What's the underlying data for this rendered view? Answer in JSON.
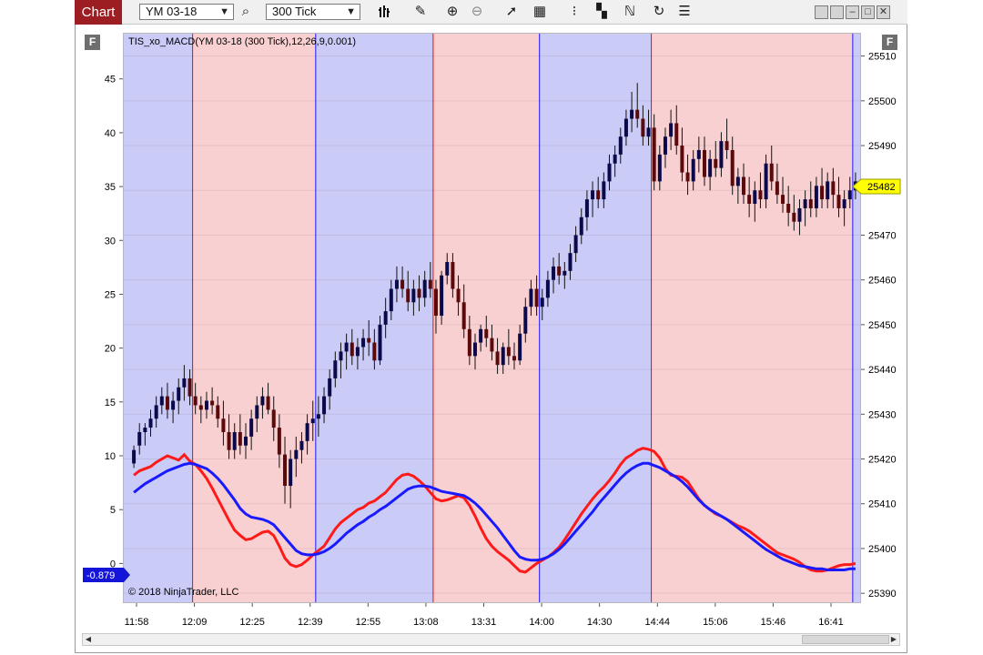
{
  "toolbar": {
    "tab_label": "Chart",
    "instrument": "YM 03-18",
    "interval": "300 Tick",
    "icons": [
      "search-icon",
      "bar-type-icon",
      "pencil-icon",
      "zoom-in-icon",
      "zoom-out-icon",
      "cursor-icon",
      "data-box-icon",
      "chart-trader-icon",
      "templates-icon",
      "strategies-icon",
      "refresh-icon",
      "properties-icon"
    ]
  },
  "badges": {
    "left_f": "F",
    "right_f": "F"
  },
  "indicator_label": "TIS_xo_MACD(YM 03-18 (300 Tick),12,26,9,0.001)",
  "copyright": "© 2018 NinjaTrader, LLC",
  "left_marker": "-0.879",
  "right_marker": "25482",
  "colors": {
    "up_candle": "#0a0a4a",
    "down_candle": "#5a0a0a",
    "blue_zone": "#cbcbf7",
    "red_zone": "#f9d0d2",
    "macd": "#ff1a1a",
    "signal": "#1a1aff"
  },
  "chart_data": {
    "type": "candlestick_with_indicator",
    "title": "",
    "x_tick_labels": [
      "11:58",
      "12:09",
      "12:25",
      "12:39",
      "12:55",
      "13:08",
      "13:31",
      "14:00",
      "14:30",
      "14:44",
      "15:06",
      "15:46",
      "16:41"
    ],
    "price_axis": {
      "ticks": [
        25390,
        25400,
        25410,
        25420,
        25430,
        25440,
        25450,
        25460,
        25470,
        25480,
        25490,
        25500,
        25510
      ],
      "ylim": [
        25388,
        25515
      ]
    },
    "indicator_axis": {
      "ticks": [
        0,
        5,
        10,
        15,
        20,
        25,
        30,
        35,
        40,
        45
      ],
      "ylim": [
        -3.6,
        49.2
      ]
    },
    "zones": [
      {
        "color": "blue",
        "start": 0,
        "end": 11
      },
      {
        "color": "red",
        "start": 11,
        "end": 33
      },
      {
        "color": "blue",
        "start": 33,
        "end": 54
      },
      {
        "color": "red",
        "start": 54,
        "end": 73
      },
      {
        "color": "blue",
        "start": 73,
        "end": 93
      },
      {
        "color": "red",
        "start": 93,
        "end": 129
      },
      {
        "color": "blue",
        "start": 129,
        "end": 130
      }
    ],
    "candles": [
      [
        25419,
        25423,
        25418,
        25422
      ],
      [
        25423,
        25428,
        25421,
        25426
      ],
      [
        25426,
        25428,
        25423,
        25427
      ],
      [
        25427,
        25431,
        25425,
        25429
      ],
      [
        25429,
        25434,
        25427,
        25432
      ],
      [
        25432,
        25436,
        25430,
        25434
      ],
      [
        25434,
        25437,
        25429,
        25431
      ],
      [
        25431,
        25435,
        25428,
        25433
      ],
      [
        25433,
        25438,
        25430,
        25436
      ],
      [
        25436,
        25441,
        25433,
        25438
      ],
      [
        25438,
        25440,
        25432,
        25434
      ],
      [
        25434,
        25437,
        25430,
        25432
      ],
      [
        25432,
        25434,
        25428,
        25431
      ],
      [
        25431,
        25435,
        25429,
        25433
      ],
      [
        25433,
        25436,
        25430,
        25432
      ],
      [
        25432,
        25434,
        25427,
        25429
      ],
      [
        25429,
        25433,
        25423,
        25426
      ],
      [
        25426,
        25430,
        25420,
        25422
      ],
      [
        25422,
        25428,
        25420,
        25426
      ],
      [
        25426,
        25430,
        25421,
        25423
      ],
      [
        25423,
        25428,
        25420,
        25425
      ],
      [
        25425,
        25431,
        25422,
        25429
      ],
      [
        25429,
        25434,
        25426,
        25432
      ],
      [
        25432,
        25436,
        25429,
        25434
      ],
      [
        25434,
        25437,
        25430,
        25431
      ],
      [
        25431,
        25434,
        25424,
        25427
      ],
      [
        25427,
        25430,
        25418,
        25421
      ],
      [
        25421,
        25425,
        25410,
        25414
      ],
      [
        25414,
        25422,
        25409,
        25420
      ],
      [
        25420,
        25425,
        25416,
        25422
      ],
      [
        25422,
        25426,
        25419,
        25424
      ],
      [
        25424,
        25430,
        25421,
        25428
      ],
      [
        25428,
        25433,
        25424,
        25429
      ],
      [
        25429,
        25434,
        25425,
        25430
      ],
      [
        25430,
        25436,
        25428,
        25434
      ],
      [
        25434,
        25440,
        25431,
        25438
      ],
      [
        25438,
        25444,
        25436,
        25442
      ],
      [
        25442,
        25446,
        25438,
        25444
      ],
      [
        25444,
        25448,
        25440,
        25446
      ],
      [
        25446,
        25449,
        25441,
        25443
      ],
      [
        25443,
        25447,
        25440,
        25445
      ],
      [
        25445,
        25449,
        25442,
        25447
      ],
      [
        25447,
        25451,
        25443,
        25446
      ],
      [
        25446,
        25449,
        25440,
        25442
      ],
      [
        25442,
        25452,
        25441,
        25450
      ],
      [
        25450,
        25456,
        25447,
        25453
      ],
      [
        25453,
        25460,
        25451,
        25458
      ],
      [
        25458,
        25463,
        25455,
        25460
      ],
      [
        25460,
        25463,
        25456,
        25458
      ],
      [
        25458,
        25462,
        25453,
        25455
      ],
      [
        25455,
        25460,
        25452,
        25458
      ],
      [
        25458,
        25461,
        25453,
        25456
      ],
      [
        25456,
        25462,
        25454,
        25460
      ],
      [
        25460,
        25464,
        25456,
        25458
      ],
      [
        25458,
        25460,
        25448,
        25452
      ],
      [
        25452,
        25462,
        25450,
        25461
      ],
      [
        25461,
        25466,
        25459,
        25464
      ],
      [
        25464,
        25466,
        25456,
        25458
      ],
      [
        25458,
        25461,
        25452,
        25455
      ],
      [
        25455,
        25459,
        25447,
        25449
      ],
      [
        25449,
        25452,
        25441,
        25443
      ],
      [
        25443,
        25448,
        25440,
        25446
      ],
      [
        25446,
        25450,
        25444,
        25449
      ],
      [
        25449,
        25452,
        25445,
        25447
      ],
      [
        25447,
        25450,
        25442,
        25444
      ],
      [
        25444,
        25447,
        25439,
        25441
      ],
      [
        25441,
        25446,
        25439,
        25445
      ],
      [
        25445,
        25449,
        25441,
        25443
      ],
      [
        25443,
        25446,
        25440,
        25442
      ],
      [
        25442,
        25450,
        25441,
        25448
      ],
      [
        25448,
        25456,
        25446,
        25454
      ],
      [
        25454,
        25460,
        25452,
        25458
      ],
      [
        25458,
        25461,
        25452,
        25454
      ],
      [
        25454,
        25458,
        25451,
        25456
      ],
      [
        25456,
        25462,
        25454,
        25460
      ],
      [
        25460,
        25465,
        25457,
        25463
      ],
      [
        25463,
        25466,
        25459,
        25461
      ],
      [
        25461,
        25464,
        25458,
        25462
      ],
      [
        25462,
        25468,
        25460,
        25466
      ],
      [
        25466,
        25472,
        25464,
        25470
      ],
      [
        25470,
        25476,
        25468,
        25474
      ],
      [
        25474,
        25480,
        25471,
        25478
      ],
      [
        25478,
        25482,
        25474,
        25480
      ],
      [
        25480,
        25483,
        25476,
        25478
      ],
      [
        25478,
        25484,
        25476,
        25482
      ],
      [
        25482,
        25488,
        25480,
        25486
      ],
      [
        25486,
        25490,
        25483,
        25488
      ],
      [
        25488,
        25494,
        25486,
        25492
      ],
      [
        25492,
        25498,
        25490,
        25496
      ],
      [
        25496,
        25502,
        25493,
        25498
      ],
      [
        25498,
        25504,
        25494,
        25496
      ],
      [
        25496,
        25499,
        25490,
        25492
      ],
      [
        25492,
        25498,
        25490,
        25494
      ],
      [
        25494,
        25497,
        25480,
        25482
      ],
      [
        25482,
        25490,
        25480,
        25488
      ],
      [
        25488,
        25494,
        25485,
        25492
      ],
      [
        25492,
        25498,
        25489,
        25495
      ],
      [
        25495,
        25499,
        25488,
        25490
      ],
      [
        25490,
        25494,
        25482,
        25484
      ],
      [
        25484,
        25488,
        25479,
        25482
      ],
      [
        25482,
        25489,
        25480,
        25487
      ],
      [
        25487,
        25492,
        25484,
        25489
      ],
      [
        25489,
        25492,
        25481,
        25483
      ],
      [
        25483,
        25489,
        25480,
        25487
      ],
      [
        25487,
        25491,
        25483,
        25485
      ],
      [
        25485,
        25493,
        25483,
        25491
      ],
      [
        25491,
        25496,
        25487,
        25489
      ],
      [
        25489,
        25492,
        25479,
        25481
      ],
      [
        25481,
        25485,
        25477,
        25483
      ],
      [
        25483,
        25486,
        25477,
        25479
      ],
      [
        25479,
        25483,
        25474,
        25477
      ],
      [
        25477,
        25482,
        25473,
        25480
      ],
      [
        25480,
        25484,
        25476,
        25478
      ],
      [
        25478,
        25488,
        25476,
        25486
      ],
      [
        25486,
        25490,
        25480,
        25482
      ],
      [
        25482,
        25486,
        25477,
        25479
      ],
      [
        25479,
        25483,
        25475,
        25477
      ],
      [
        25477,
        25481,
        25472,
        25475
      ],
      [
        25475,
        25479,
        25471,
        25473
      ],
      [
        25473,
        25478,
        25470,
        25476
      ],
      [
        25476,
        25480,
        25472,
        25478
      ],
      [
        25478,
        25482,
        25474,
        25476
      ],
      [
        25476,
        25483,
        25474,
        25481
      ],
      [
        25481,
        25485,
        25476,
        25478
      ],
      [
        25478,
        25484,
        25476,
        25482
      ],
      [
        25482,
        25485,
        25476,
        25479
      ],
      [
        25479,
        25483,
        25474,
        25476
      ],
      [
        25476,
        25480,
        25472,
        25478
      ],
      [
        25478,
        25483,
        25476,
        25480
      ],
      [
        25480,
        25484,
        25478,
        25482
      ]
    ],
    "macd": [
      8.2,
      8.6,
      8.8,
      9.0,
      9.4,
      9.7,
      10.0,
      9.8,
      9.6,
      10.1,
      9.5,
      9.2,
      8.6,
      7.9,
      7.0,
      6.0,
      5.0,
      4.0,
      3.1,
      2.6,
      2.2,
      2.3,
      2.6,
      2.9,
      3.0,
      2.6,
      1.6,
      0.5,
      -0.1,
      -0.3,
      -0.1,
      0.3,
      0.8,
      1.2,
      1.6,
      2.4,
      3.2,
      3.8,
      4.2,
      4.6,
      5.0,
      5.2,
      5.6,
      5.8,
      6.2,
      6.6,
      7.2,
      7.8,
      8.2,
      8.3,
      8.1,
      7.7,
      7.2,
      6.6,
      6.0,
      5.8,
      5.9,
      6.1,
      6.3,
      6.1,
      5.4,
      4.4,
      3.3,
      2.3,
      1.6,
      1.1,
      0.7,
      0.3,
      -0.2,
      -0.7,
      -0.8,
      -0.4,
      0.0,
      0.3,
      0.6,
      1.0,
      1.5,
      2.2,
      3.0,
      3.8,
      4.6,
      5.3,
      6.0,
      6.6,
      7.1,
      7.7,
      8.4,
      9.2,
      9.8,
      10.1,
      10.5,
      10.7,
      10.6,
      10.4,
      9.8,
      8.8,
      8.2,
      8.1,
      8.0,
      7.6,
      6.8,
      6.0,
      5.4,
      5.0,
      4.6,
      4.4,
      4.1,
      3.8,
      3.5,
      3.3,
      3.0,
      2.6,
      2.2,
      1.8,
      1.4,
      1.0,
      0.8,
      0.6,
      0.4,
      0.1,
      -0.3,
      -0.6,
      -0.7,
      -0.7,
      -0.6,
      -0.4,
      -0.2,
      -0.1,
      -0.1,
      0.0
    ],
    "signal": [
      6.6,
      7.0,
      7.4,
      7.7,
      8.0,
      8.3,
      8.6,
      8.8,
      9.0,
      9.2,
      9.3,
      9.2,
      9.0,
      8.8,
      8.4,
      7.9,
      7.3,
      6.6,
      5.9,
      5.1,
      4.6,
      4.3,
      4.2,
      4.1,
      3.9,
      3.6,
      3.0,
      2.4,
      1.8,
      1.2,
      0.9,
      0.8,
      0.8,
      0.9,
      1.1,
      1.4,
      1.8,
      2.3,
      2.8,
      3.2,
      3.6,
      3.9,
      4.3,
      4.6,
      5.0,
      5.3,
      5.7,
      6.1,
      6.5,
      6.9,
      7.1,
      7.2,
      7.2,
      7.1,
      6.9,
      6.7,
      6.6,
      6.5,
      6.4,
      6.3,
      6.0,
      5.6,
      5.1,
      4.5,
      3.9,
      3.3,
      2.6,
      1.9,
      1.2,
      0.6,
      0.4,
      0.3,
      0.3,
      0.4,
      0.6,
      0.9,
      1.3,
      1.8,
      2.4,
      3.0,
      3.6,
      4.2,
      4.8,
      5.5,
      6.1,
      6.7,
      7.3,
      7.9,
      8.4,
      8.8,
      9.1,
      9.3,
      9.3,
      9.1,
      8.9,
      8.6,
      8.3,
      8.0,
      7.6,
      7.1,
      6.5,
      5.9,
      5.4,
      5.0,
      4.7,
      4.4,
      4.1,
      3.7,
      3.3,
      2.9,
      2.5,
      2.1,
      1.7,
      1.3,
      1.0,
      0.7,
      0.4,
      0.2,
      0.0,
      -0.2,
      -0.3,
      -0.4,
      -0.5,
      -0.5,
      -0.6,
      -0.6,
      -0.6,
      -0.6,
      -0.5,
      -0.5
    ]
  }
}
